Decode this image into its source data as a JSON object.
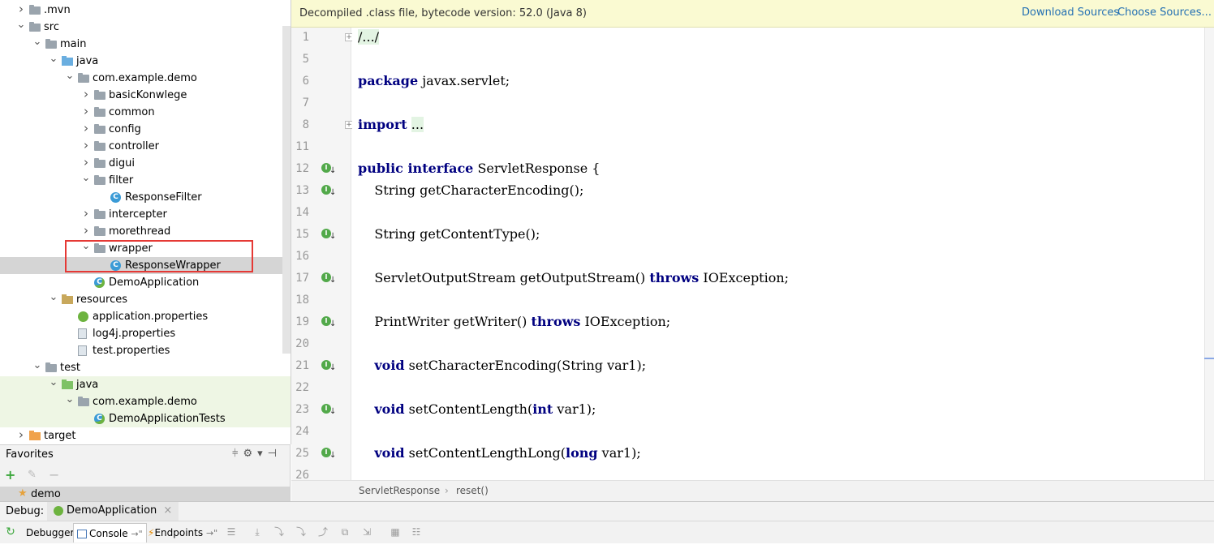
{
  "project_tree": {
    "items": [
      {
        "label": ".mvn",
        "depth": 1,
        "arrow": "collapsed",
        "icon": "folder-gray"
      },
      {
        "label": "src",
        "depth": 1,
        "arrow": "expanded",
        "icon": "folder-gray"
      },
      {
        "label": "main",
        "depth": 2,
        "arrow": "expanded",
        "icon": "folder-gray"
      },
      {
        "label": "java",
        "depth": 3,
        "arrow": "expanded",
        "icon": "folder-blue"
      },
      {
        "label": "com.example.demo",
        "depth": 4,
        "arrow": "expanded",
        "icon": "folder-gray"
      },
      {
        "label": "basicKonwlege",
        "depth": 5,
        "arrow": "collapsed",
        "icon": "folder-gray"
      },
      {
        "label": "common",
        "depth": 5,
        "arrow": "collapsed",
        "icon": "folder-gray"
      },
      {
        "label": "config",
        "depth": 5,
        "arrow": "collapsed",
        "icon": "folder-gray"
      },
      {
        "label": "controller",
        "depth": 5,
        "arrow": "collapsed",
        "icon": "folder-gray"
      },
      {
        "label": "digui",
        "depth": 5,
        "arrow": "collapsed",
        "icon": "folder-gray"
      },
      {
        "label": "filter",
        "depth": 5,
        "arrow": "expanded",
        "icon": "folder-gray"
      },
      {
        "label": "ResponseFilter",
        "depth": 6,
        "arrow": "none",
        "icon": "class-icon"
      },
      {
        "label": "intercepter",
        "depth": 5,
        "arrow": "collapsed",
        "icon": "folder-gray"
      },
      {
        "label": "morethread",
        "depth": 5,
        "arrow": "collapsed",
        "icon": "folder-gray"
      },
      {
        "label": "wrapper",
        "depth": 5,
        "arrow": "expanded",
        "icon": "folder-gray"
      },
      {
        "label": "ResponseWrapper",
        "depth": 6,
        "arrow": "none",
        "icon": "class-icon",
        "selected": true
      },
      {
        "label": "DemoApplication",
        "depth": 5,
        "arrow": "none",
        "icon": "spring-class-icon"
      },
      {
        "label": "resources",
        "depth": 3,
        "arrow": "expanded",
        "icon": "folder-res"
      },
      {
        "label": "application.properties",
        "depth": 4,
        "arrow": "none",
        "icon": "spring-icon"
      },
      {
        "label": "log4j.properties",
        "depth": 4,
        "arrow": "none",
        "icon": "props-icon"
      },
      {
        "label": "test.properties",
        "depth": 4,
        "arrow": "none",
        "icon": "props-icon"
      },
      {
        "label": "test",
        "depth": 2,
        "arrow": "expanded",
        "icon": "folder-gray"
      },
      {
        "label": "java",
        "depth": 3,
        "arrow": "expanded",
        "icon": "folder-green",
        "test": true
      },
      {
        "label": "com.example.demo",
        "depth": 4,
        "arrow": "expanded",
        "icon": "folder-gray",
        "test": true
      },
      {
        "label": "DemoApplicationTests",
        "depth": 5,
        "arrow": "none",
        "icon": "spring-class-icon",
        "test": true
      },
      {
        "label": "target",
        "depth": 1,
        "arrow": "collapsed",
        "icon": "folder-orange"
      }
    ]
  },
  "favorites": {
    "title": "Favorites",
    "item": "demo"
  },
  "editor": {
    "banner_text": "Decompiled .class file, bytecode version: 52.0 (Java 8)",
    "download_sources": "Download Sources",
    "choose_sources": "Choose Sources...",
    "lines": [
      {
        "num": "1",
        "html": "<span class=\"fold\">/.../</span>",
        "fold": true
      },
      {
        "num": "5",
        "html": ""
      },
      {
        "num": "6",
        "html": "<span class=\"kw\">package</span> javax.servlet;"
      },
      {
        "num": "7",
        "html": ""
      },
      {
        "num": "8",
        "html": "<span class=\"kw\">import</span> <span class=\"fold\">...</span>",
        "fold": true
      },
      {
        "num": "11",
        "html": ""
      },
      {
        "num": "12",
        "html": "<span class=\"kw\">public interface</span> ServletResponse {",
        "impl": true
      },
      {
        "num": "13",
        "html": "    String getCharacterEncoding();",
        "impl": true
      },
      {
        "num": "14",
        "html": ""
      },
      {
        "num": "15",
        "html": "    String getContentType();",
        "impl": true
      },
      {
        "num": "16",
        "html": ""
      },
      {
        "num": "17",
        "html": "    ServletOutputStream getOutputStream() <span class=\"kw\">throws</span> IOException;",
        "impl": true
      },
      {
        "num": "18",
        "html": ""
      },
      {
        "num": "19",
        "html": "    PrintWriter getWriter() <span class=\"kw\">throws</span> IOException;",
        "impl": true
      },
      {
        "num": "20",
        "html": ""
      },
      {
        "num": "21",
        "html": "    <span class=\"kw\">void</span> setCharacterEncoding(String var1);",
        "impl": true
      },
      {
        "num": "22",
        "html": ""
      },
      {
        "num": "23",
        "html": "    <span class=\"kw\">void</span> setContentLength(<span class=\"kw\">int</span> var1);",
        "impl": true
      },
      {
        "num": "24",
        "html": ""
      },
      {
        "num": "25",
        "html": "    <span class=\"kw\">void</span> setContentLengthLong(<span class=\"kw\">long</span> var1);",
        "impl": true
      },
      {
        "num": "26",
        "html": ""
      }
    ]
  },
  "breadcrumb": {
    "class_name": "ServletResponse",
    "separator": "›",
    "method": "reset()"
  },
  "debug": {
    "label": "Debug:",
    "config_tab": "DemoApplication",
    "close": "×",
    "tabs": {
      "debugger": "Debugger",
      "console": "Console",
      "console_suffix": "→\"",
      "endpoints": "Endpoints",
      "endpoints_suffix": "→\""
    }
  }
}
